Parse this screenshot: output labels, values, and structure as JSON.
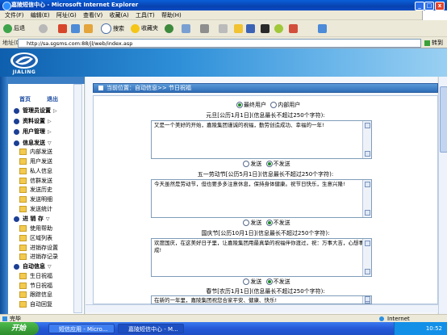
{
  "window": {
    "title": "嘉陵短信中心 - Microsoft Internet Explorer"
  },
  "menu": [
    "文件(F)",
    "编辑(E)",
    "阿址(G)",
    "查看(V)",
    "收藏(A)",
    "工具(T)",
    "帮助(H)"
  ],
  "toolbar": {
    "back": "后退",
    "search": "搜索",
    "favorites": "收藏夹"
  },
  "address": {
    "label": "地址(D)",
    "url": "http://sa.sgsms.com:88/jl/web/index.asp",
    "go": "转到"
  },
  "brand": {
    "logo_text": "JIALING"
  },
  "nav": {
    "home": "首页",
    "logout": "退出",
    "sections": [
      {
        "label": "管理员设置"
      },
      {
        "label": "资料设置"
      },
      {
        "label": "用户管理"
      },
      {
        "label": "信息发送",
        "items": [
          "内部发送",
          "用户发送",
          "私人信息",
          "信群发送",
          "发送历史",
          "发送明细",
          "发送统计"
        ]
      },
      {
        "label": "进 销 存",
        "items": [
          "使用帮助",
          "区域列表",
          "进销存设置",
          "进销存记录"
        ]
      },
      {
        "label": "自动信息",
        "items": [
          "生日祝福",
          "节日祝福",
          "跟踪信息",
          "自动回复"
        ]
      }
    ]
  },
  "main": {
    "breadcrumb": "当前位置：自动信息>> 节日祝福",
    "user_options": [
      "最终用户",
      "内部用户"
    ],
    "send_options": [
      "发送",
      "不发送"
    ],
    "holidays": [
      {
        "title": "元旦[公历1月1日](信息最长不超过250个字符):",
        "text": "又是一个美好的开始，嘉陵集团谨诚的祝福，勤劳创造成功、幸福的一年!"
      },
      {
        "title": "五一劳动节[公历5月1日](信息最长不超过250个字符):",
        "text": "今天虽然是劳动节，但也要多多注意休息，保持身体健康。祝节日快乐，生意兴隆!"
      },
      {
        "title": "国庆节[公历10月1日](信息最长不超过250个字符):",
        "text": "欢度国庆，在这美好日子里，让嘉陵集团用最真挚的祝福伴你渡过，祝：万事大吉，心想事成!"
      },
      {
        "title": "春节[农历1月1日](信息最长不超过250个字符):",
        "text": "在新的一年里，嘉陵集团祝您合家平安、健康、快乐!"
      }
    ]
  },
  "status": {
    "left": "完毕",
    "zone": "Internet"
  },
  "taskbar": {
    "start": "开始",
    "tasks": [
      "短信应用 - Micro...",
      "嘉陵短信中心 - M..."
    ],
    "clock": "10:52"
  },
  "colors": {
    "accent": "#2f6db7",
    "banner": "#1e74c4",
    "taskbar": "#2458d6"
  }
}
